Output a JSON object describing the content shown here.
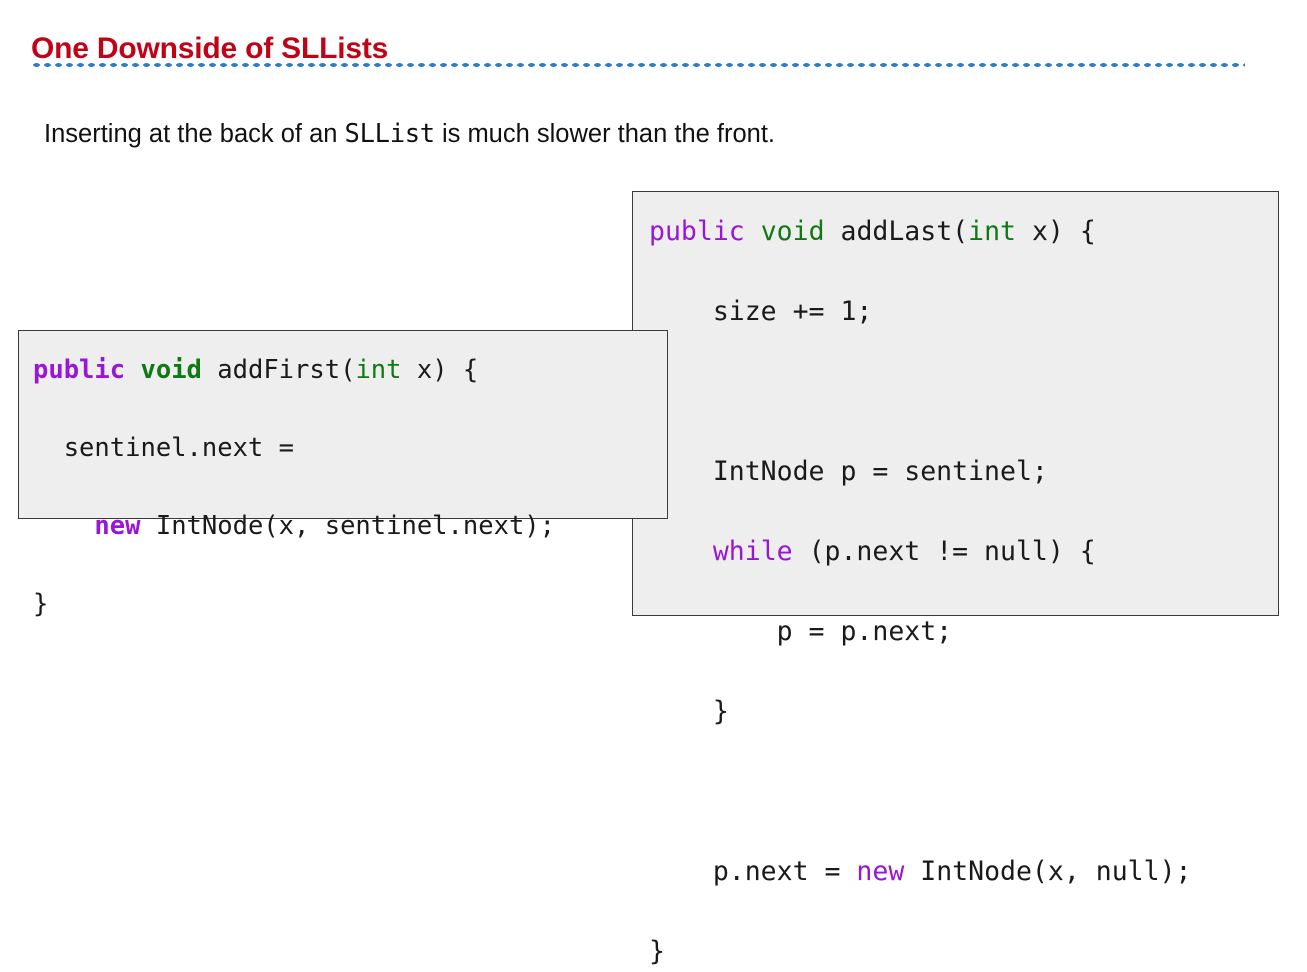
{
  "slide": {
    "title": "One Downside of SLLists",
    "title_color": "#c00418",
    "rule_color": "#2e7cc4",
    "subtitle": {
      "part1": "Inserting at the back of an ",
      "code": "SLList",
      "part2": " is much slower than the front."
    }
  },
  "code_blocks": [
    {
      "name": "addFirst",
      "background": "#eeeeee",
      "border_color": "#3a3a3a",
      "lines": [
        [
          {
            "t": "public",
            "s": "kw-purple-b"
          },
          {
            "t": " ",
            "s": ""
          },
          {
            "t": "void",
            "s": "kw-green-b"
          },
          {
            "t": " addFirst(",
            "s": ""
          },
          {
            "t": "int",
            "s": "kw-green"
          },
          {
            "t": " x) {",
            "s": ""
          }
        ],
        [
          {
            "t": "  sentinel.next =",
            "s": ""
          }
        ],
        [
          {
            "t": "    ",
            "s": ""
          },
          {
            "t": "new",
            "s": "kw-purple-b"
          },
          {
            "t": " IntNode(x, sentinel.next);",
            "s": ""
          }
        ],
        [
          {
            "t": "}",
            "s": ""
          }
        ]
      ]
    },
    {
      "name": "addLast",
      "background": "#eeeeee",
      "border_color": "#3a3a3a",
      "lines": [
        [
          {
            "t": "public",
            "s": "kw-purple"
          },
          {
            "t": " ",
            "s": ""
          },
          {
            "t": "void",
            "s": "kw-green"
          },
          {
            "t": " addLast(",
            "s": ""
          },
          {
            "t": "int",
            "s": "kw-green"
          },
          {
            "t": " x) {",
            "s": ""
          }
        ],
        [
          {
            "t": "    size += 1;",
            "s": ""
          }
        ],
        [
          {
            "t": "",
            "s": ""
          }
        ],
        [
          {
            "t": "    IntNode p = sentinel;",
            "s": ""
          }
        ],
        [
          {
            "t": "    ",
            "s": ""
          },
          {
            "t": "while",
            "s": "kw-purple"
          },
          {
            "t": " (p.next != null) {",
            "s": ""
          }
        ],
        [
          {
            "t": "        p = p.next;",
            "s": ""
          }
        ],
        [
          {
            "t": "    }",
            "s": ""
          }
        ],
        [
          {
            "t": "",
            "s": ""
          }
        ],
        [
          {
            "t": "    p.next = ",
            "s": ""
          },
          {
            "t": "new",
            "s": "kw-purple"
          },
          {
            "t": " IntNode(x, null);",
            "s": ""
          }
        ],
        [
          {
            "t": "}",
            "s": ""
          }
        ]
      ]
    }
  ]
}
